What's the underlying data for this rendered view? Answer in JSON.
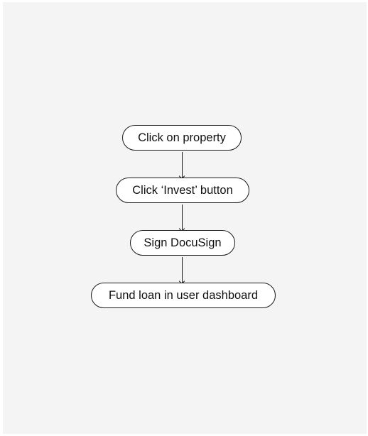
{
  "flowchart": {
    "steps": [
      {
        "label": "Click on property"
      },
      {
        "label": "Click ‘Invest’ button"
      },
      {
        "label": "Sign DocuSign"
      },
      {
        "label": "Fund loan in user dashboard"
      }
    ]
  },
  "colors": {
    "background": "#f4f4f4",
    "node_fill": "#ffffff",
    "stroke": "#1a1a1a",
    "text": "#111111"
  }
}
